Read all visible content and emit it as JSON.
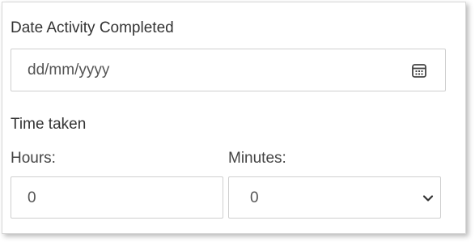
{
  "form": {
    "date_label": "Date Activity Completed",
    "date_placeholder": "dd/mm/yyyy",
    "date_icon": "calendar-icon",
    "time_label": "Time taken",
    "hours_label": "Hours:",
    "hours_value": "0",
    "minutes_label": "Minutes:",
    "minutes_value": "0",
    "minutes_icon": "chevron-down-icon"
  }
}
